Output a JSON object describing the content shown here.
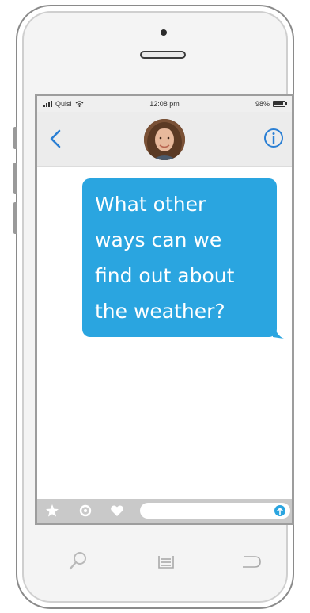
{
  "status_bar": {
    "carrier": "Quisi",
    "time": "12:08 pm",
    "battery": "98%"
  },
  "navbar": {
    "back_icon": "chevron-left-icon",
    "avatar_icon": "contact-avatar",
    "info_icon": "info-icon"
  },
  "messages": [
    {
      "direction": "outgoing",
      "lines": [
        "What other",
        "ways can we",
        "find out about",
        "the weather?"
      ]
    }
  ],
  "composer": {
    "icons": [
      "star-icon",
      "gear-icon",
      "heart-icon",
      "send-icon"
    ],
    "input_value": ""
  },
  "home_bar_icons": [
    "search-icon",
    "menu-icon",
    "back-arrow-icon"
  ],
  "colors": {
    "accent": "#2aa5e0",
    "bubble_text": "#ffffff",
    "navbar_bg": "#ececec",
    "composer_bg": "#c9c9c9"
  }
}
